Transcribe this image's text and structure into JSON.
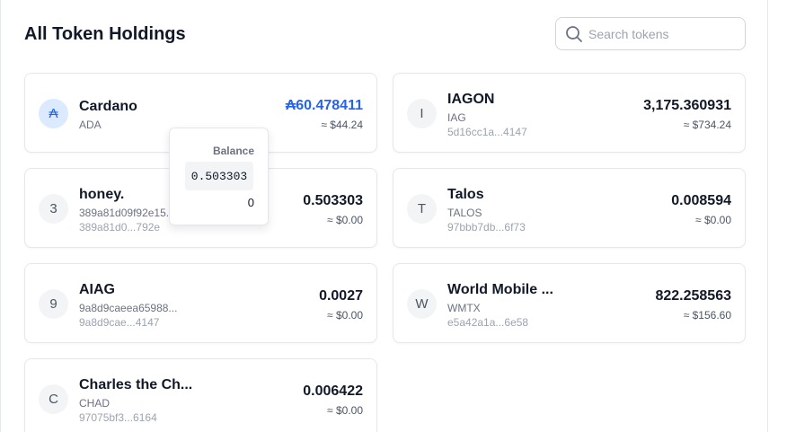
{
  "header": {
    "title": "All Token Holdings"
  },
  "search": {
    "placeholder": "Search tokens",
    "icon": "search-icon"
  },
  "tokens": [
    {
      "avatar": "₳",
      "name": "Cardano",
      "ticker": "ADA",
      "policy": "",
      "amount": "₳60.478411",
      "value": "≈ $44.24"
    },
    {
      "avatar": "I",
      "name": "IAGON",
      "ticker": "IAG",
      "policy": "5d16cc1a...4147",
      "amount": "3,175.360931",
      "value": "≈ $734.24"
    },
    {
      "avatar": "3",
      "name": "honey.",
      "ticker": "389a81d09f92e15...",
      "policy": "389a81d0...792e",
      "amount": "0.503303",
      "value": "≈ $0.00"
    },
    {
      "avatar": "T",
      "name": "Talos",
      "ticker": "TALOS",
      "policy": "97bbb7db...6f73",
      "amount": "0.008594",
      "value": "≈ $0.00"
    },
    {
      "avatar": "9",
      "name": "AIAG",
      "ticker": "9a8d9caeea65988...",
      "policy": "9a8d9cae...4147",
      "amount": "0.0027",
      "value": "≈ $0.00"
    },
    {
      "avatar": "W",
      "name": "World Mobile ...",
      "ticker": "WMTX",
      "policy": "e5a42a1a...6e58",
      "amount": "822.258563",
      "value": "≈ $156.60"
    },
    {
      "avatar": "C",
      "name": "Charles the Ch...",
      "ticker": "CHAD",
      "policy": "97075bf3...6164",
      "amount": "0.006422",
      "value": "≈ $0.00"
    }
  ],
  "tooltip": {
    "label": "Balance",
    "value": "0.503303",
    "zero": "0"
  },
  "colors": {
    "accent": "#2563eb",
    "avatar_bg": "#f3f4f6",
    "border": "#e5e7eb"
  }
}
